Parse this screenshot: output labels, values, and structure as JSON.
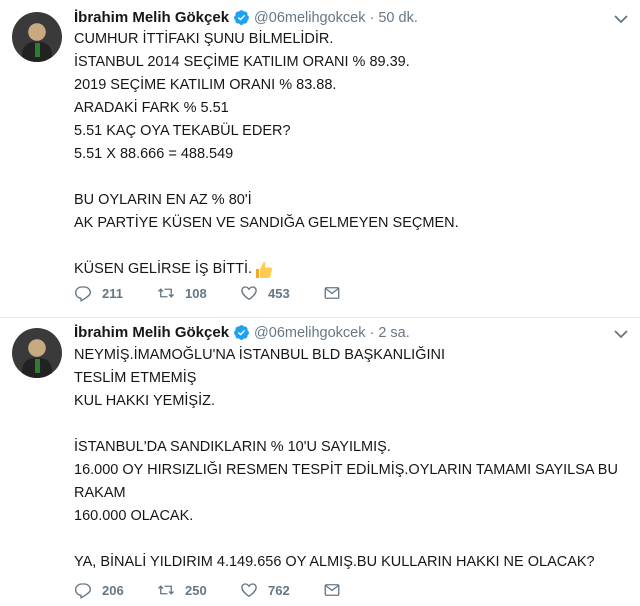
{
  "tweets": [
    {
      "name": "İbrahim Melih Gökçek",
      "handle": "@06melihgokcek",
      "separator": "·",
      "time": "50 dk.",
      "lines": [
        "CUMHUR İTTİFAKI ŞUNU BİLMELİDİR.",
        "İSTANBUL 2014 SEÇİME KATILIM ORANI % 89.39.",
        "2019 SEÇİME KATILIM ORANI % 83.88.",
        "ARADAKİ FARK % 5.51",
        "5.51 KAÇ OYA TEKABÜL EDER?",
        "5.51 X 88.666 = 488.549",
        "",
        "BU OYLARIN EN AZ % 80'İ",
        "AK PARTİYE KÜSEN VE SANDIĞA GELMEYEN SEÇMEN.",
        "",
        "KÜSEN GELİRSE İŞ BİTTİ."
      ],
      "replies": "211",
      "retweets": "108",
      "likes": "453"
    },
    {
      "name": "İbrahim Melih Gökçek",
      "handle": "@06melihgokcek",
      "separator": "·",
      "time": "2 sa.",
      "lines": [
        "NEYMİŞ.İMAMOĞLU'NA İSTANBUL BLD BAŞKANLIĞINI",
        "TESLİM ETMEMİŞ",
        "KUL HAKKI YEMİŞİZ.",
        "",
        "İSTANBUL'DA SANDIKLARIN % 10'U SAYILMIŞ.",
        "16.000 OY HIRSIZLIĞI RESMEN TESPİT EDİLMİŞ.OYLARIN TAMAMI SAYILSA BU",
        "RAKAM",
        "160.000 OLACAK.",
        "",
        "YA, BİNALİ YILDIRIM 4.149.656 OY ALMIŞ.BU KULLARIN HAKKI NE OLACAK?"
      ],
      "replies": "206",
      "retweets": "250",
      "likes": "762"
    }
  ],
  "icons": {
    "verified": "verified-badge-icon",
    "thumbs_up": "thumbs-up-emoji-icon",
    "reply": "reply-icon",
    "retweet": "retweet-icon",
    "like": "heart-icon",
    "dm": "envelope-icon",
    "caret": "chevron-down-icon"
  },
  "colors": {
    "verified": "#1da1f2",
    "muted": "#657786",
    "text": "#14171a",
    "divider": "#e6ecf0"
  }
}
